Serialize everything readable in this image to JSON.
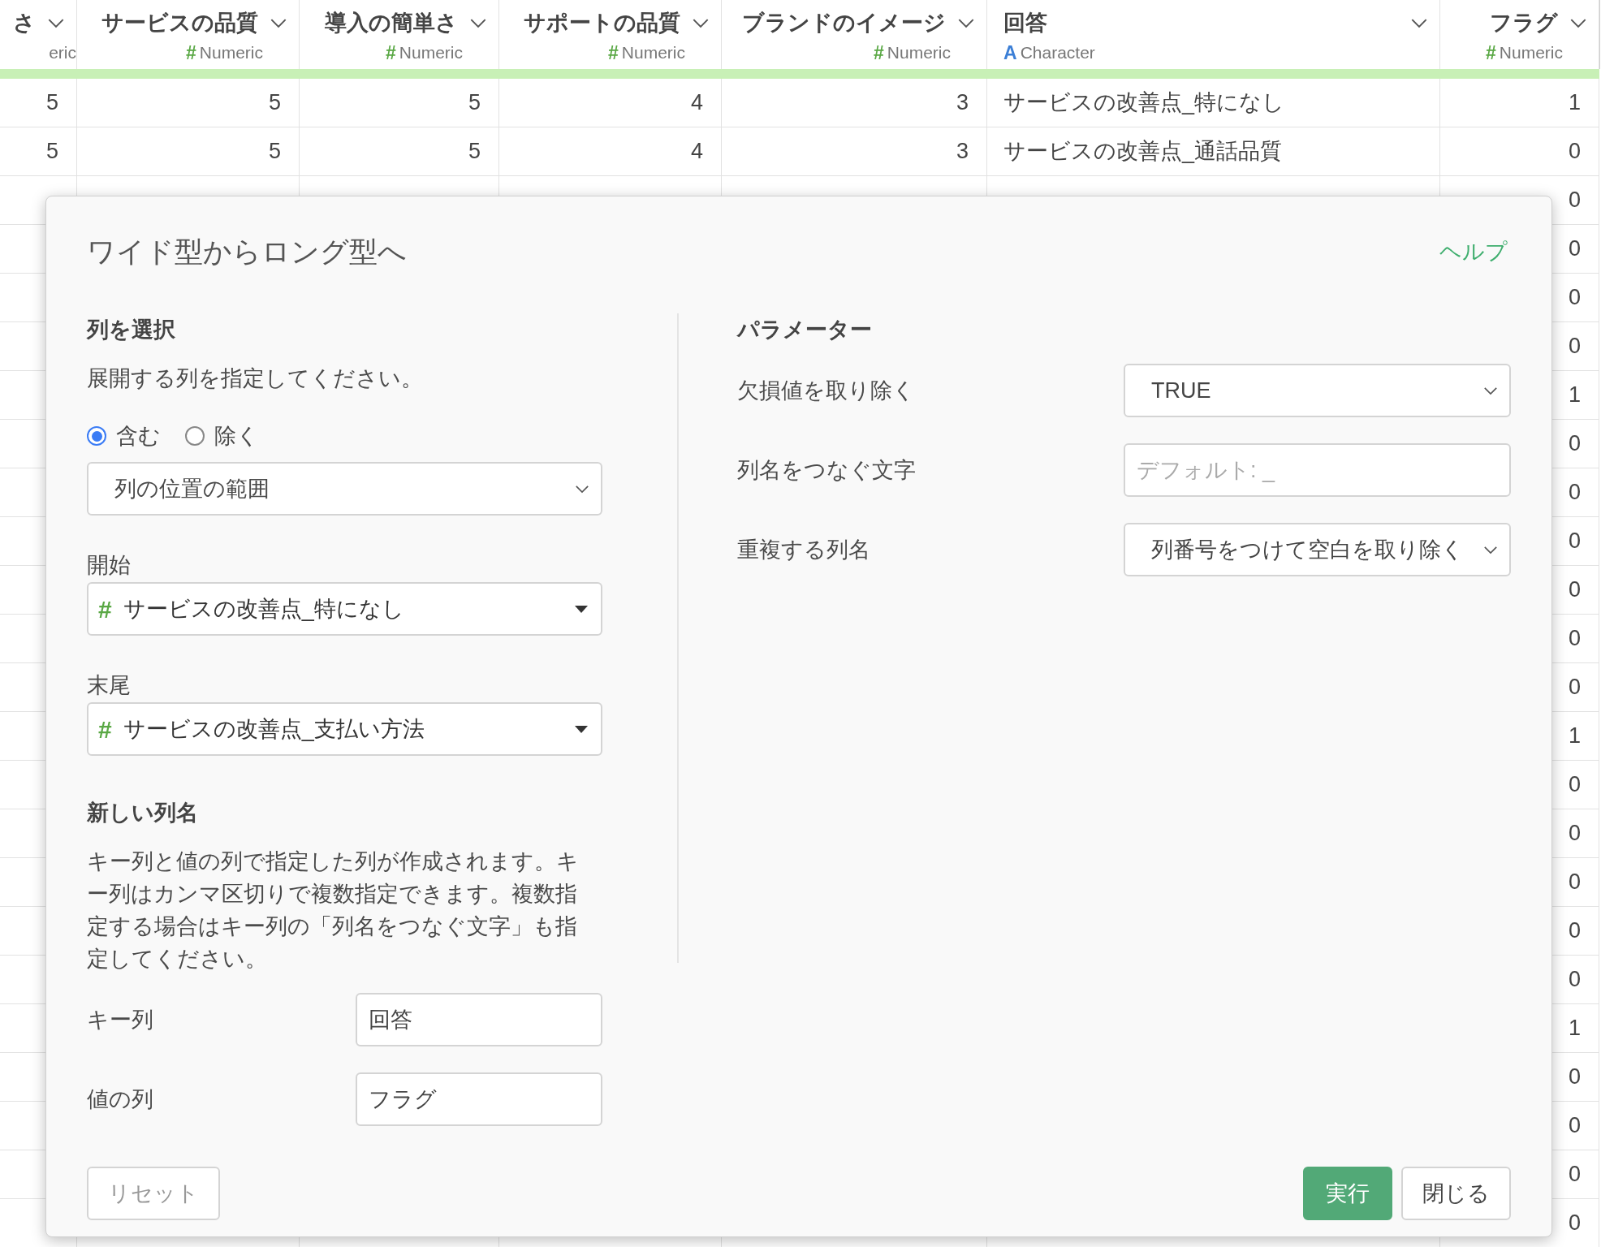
{
  "table": {
    "columns": [
      {
        "name": "さ",
        "type": "eric",
        "kind": "numeric"
      },
      {
        "name": "サービスの品質",
        "type_icon": "#",
        "type": "Numeric",
        "kind": "numeric"
      },
      {
        "name": "導入の簡単さ",
        "type_icon": "#",
        "type": "Numeric",
        "kind": "numeric"
      },
      {
        "name": "サポートの品質",
        "type_icon": "#",
        "type": "Numeric",
        "kind": "numeric"
      },
      {
        "name": "ブランドのイメージ",
        "type_icon": "#",
        "type": "Numeric",
        "kind": "numeric"
      },
      {
        "name": "回答",
        "type_icon": "A",
        "type": "Character",
        "kind": "character"
      },
      {
        "name": "フラグ",
        "type_icon": "#",
        "type": "Numeric",
        "kind": "numeric"
      }
    ],
    "rows": [
      {
        "cells": [
          "5",
          "5",
          "5",
          "4",
          "3",
          "サービスの改善点_特になし",
          "1"
        ]
      },
      {
        "cells": [
          "5",
          "5",
          "5",
          "4",
          "3",
          "サービスの改善点_通話品質",
          "0"
        ]
      },
      {
        "cells": [
          "0"
        ]
      },
      {
        "cells": [
          "0"
        ]
      },
      {
        "cells": [
          "0"
        ]
      },
      {
        "cells": [
          "0"
        ]
      },
      {
        "cells": [
          "1"
        ]
      },
      {
        "cells": [
          "0"
        ]
      },
      {
        "cells": [
          "0"
        ]
      },
      {
        "cells": [
          "0"
        ]
      },
      {
        "cells": [
          "0"
        ]
      },
      {
        "cells": [
          "0"
        ]
      },
      {
        "cells": [
          "0"
        ]
      },
      {
        "cells": [
          "1"
        ]
      },
      {
        "cells": [
          "0"
        ]
      },
      {
        "cells": [
          "0"
        ]
      },
      {
        "cells": [
          "0"
        ]
      },
      {
        "cells": [
          "0"
        ]
      },
      {
        "cells": [
          "0"
        ]
      },
      {
        "cells": [
          "1"
        ]
      },
      {
        "cells": [
          "0"
        ]
      },
      {
        "cells": [
          "0"
        ]
      },
      {
        "cells": [
          "0"
        ]
      },
      {
        "cells": [
          "0"
        ]
      }
    ]
  },
  "dialog": {
    "title": "ワイド型からロング型へ",
    "help_link": "ヘルプ",
    "left": {
      "heading": "列を選択",
      "description": "展開する列を指定してください。",
      "radios": [
        {
          "label": "含む",
          "selected": true
        },
        {
          "label": "除く",
          "selected": false
        }
      ],
      "mode_select": "列の位置の範囲",
      "start": {
        "label": "開始",
        "type_icon": "#",
        "value": "サービスの改善点_特になし"
      },
      "end": {
        "label": "末尾",
        "type_icon": "#",
        "value": "サービスの改善点_支払い方法"
      },
      "new_heading": "新しい列名",
      "new_description": "キー列と値の列で指定した列が作成されます。キー列はカンマ区切りで複数指定できます。複数指定する場合はキー列の「列名をつなぐ文字」も指定してください。",
      "fields": [
        {
          "label": "キー列",
          "value": "回答"
        },
        {
          "label": "値の列",
          "value": "フラグ"
        }
      ]
    },
    "right": {
      "heading": "パラメーター",
      "params": [
        {
          "label": "欠損値を取り除く",
          "kind": "select",
          "value": "TRUE"
        },
        {
          "label": "列名をつなぐ文字",
          "kind": "input",
          "placeholder": "デフォルト: _"
        },
        {
          "label": "重複する列名",
          "kind": "select",
          "value": "列番号をつけて空白を取り除く"
        }
      ]
    },
    "buttons": [
      {
        "label": "リセット",
        "kind": "secondary"
      },
      {
        "label": "実行",
        "kind": "primary"
      },
      {
        "label": "閉じる",
        "kind": "secondary"
      }
    ]
  }
}
